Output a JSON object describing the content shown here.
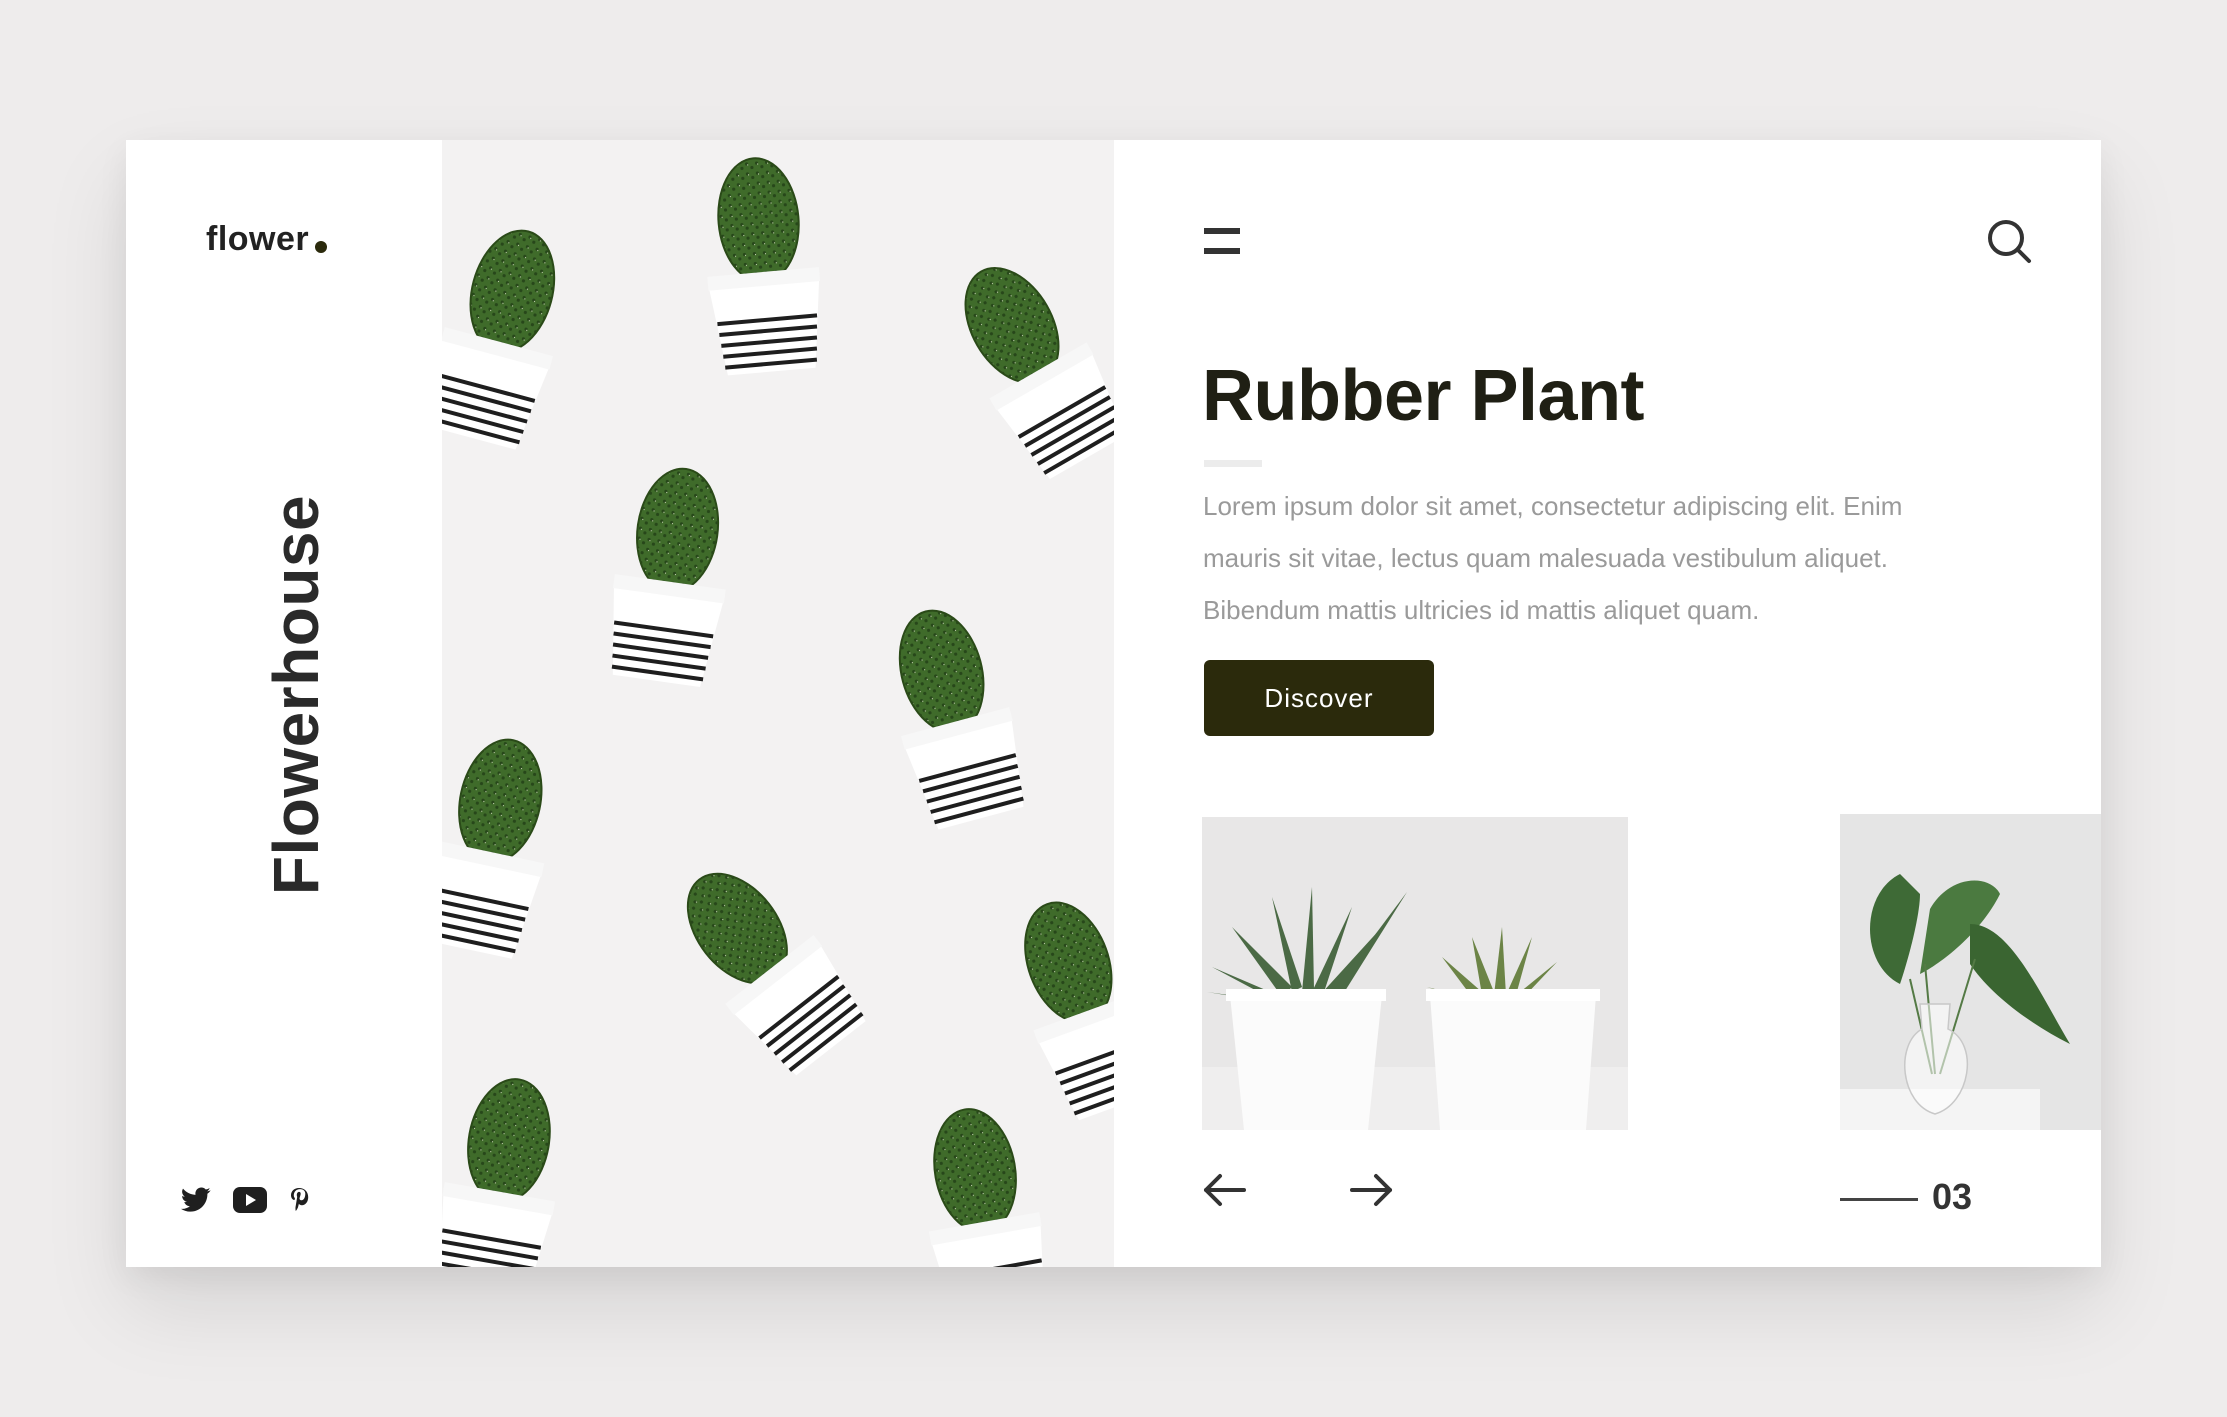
{
  "brand": {
    "logo_text": "flower",
    "vertical_name": "Flowerhouse"
  },
  "socials": [
    {
      "icon": "twitter-icon"
    },
    {
      "icon": "youtube-icon"
    },
    {
      "icon": "pinterest-icon"
    }
  ],
  "header": {
    "menu_icon": "menu-icon",
    "search_icon": "search-icon"
  },
  "product": {
    "title": "Rubber Plant",
    "description": "Lorem ipsum dolor sit amet, consectetur adipiscing elit. Enim mauris sit vitae, lectus quam malesuada vestibulum aliquet. Bibendum mattis ultricies id mattis aliquet quam.",
    "cta_label": "Discover"
  },
  "slider": {
    "counter": "03",
    "prev_icon": "arrow-left-icon",
    "next_icon": "arrow-right-icon"
  },
  "colors": {
    "accent": "#2b2a0c",
    "text": "#1f1f1f",
    "muted": "#9a9a9a",
    "background": "#eeecec"
  }
}
